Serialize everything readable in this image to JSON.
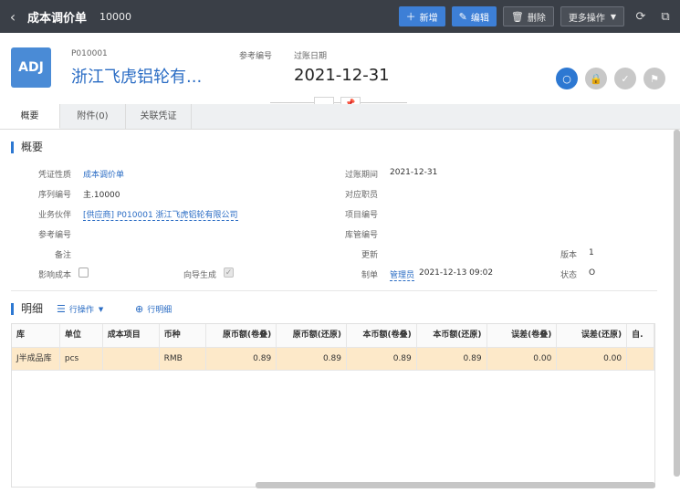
{
  "topbar": {
    "title": "成本调价单",
    "doc_no": "10000",
    "buttons": {
      "new": "新增",
      "edit": "编辑",
      "delete": "删除",
      "more": "更多操作"
    }
  },
  "header": {
    "avatar_text": "ADJ",
    "code": "P010001",
    "partner_short": "浙江飞虎铝轮有...",
    "ref_label": "参考编号",
    "date_label": "过账日期",
    "date_value": "2021-12-31"
  },
  "tabs": [
    "概要",
    "附件(0)",
    "关联凭证"
  ],
  "overview": {
    "title": "概要",
    "labels": {
      "voucher_type": "凭证性质",
      "serial_no": "序列编号",
      "partner": "业务伙伴",
      "ref_no": "参考编号",
      "remark": "备注",
      "affect_cost": "影响成本",
      "wizard": "向导生成",
      "period": "过账期间",
      "staff": "对应职员",
      "project": "项目编号",
      "bin": "库管编号",
      "updated": "更新",
      "maker": "制单",
      "version": "版本",
      "state": "状态"
    },
    "values": {
      "voucher_type": "成本调价单",
      "serial_no": "主.10000",
      "partner": "[供应商] P010001 浙江飞虎铝轮有限公司",
      "period": "2021-12-31",
      "maker_name": "管理员",
      "maker_time": "2021-12-13 09:02",
      "version": "1",
      "state": "O"
    }
  },
  "detail": {
    "title": "明细",
    "row_ops": "行操作",
    "row_detail": "行明细",
    "columns": [
      "库",
      "单位",
      "成本项目",
      "币种",
      "原币额(卷叠)",
      "原币额(还原)",
      "本币额(卷叠)",
      "本币额(还原)",
      "误差(卷叠)",
      "误差(还原)",
      "自."
    ],
    "rows": [
      [
        "J半成品库",
        "pcs",
        "",
        "RMB",
        "0.89",
        "0.89",
        "0.89",
        "0.89",
        "0.00",
        "0.00",
        ""
      ]
    ]
  }
}
